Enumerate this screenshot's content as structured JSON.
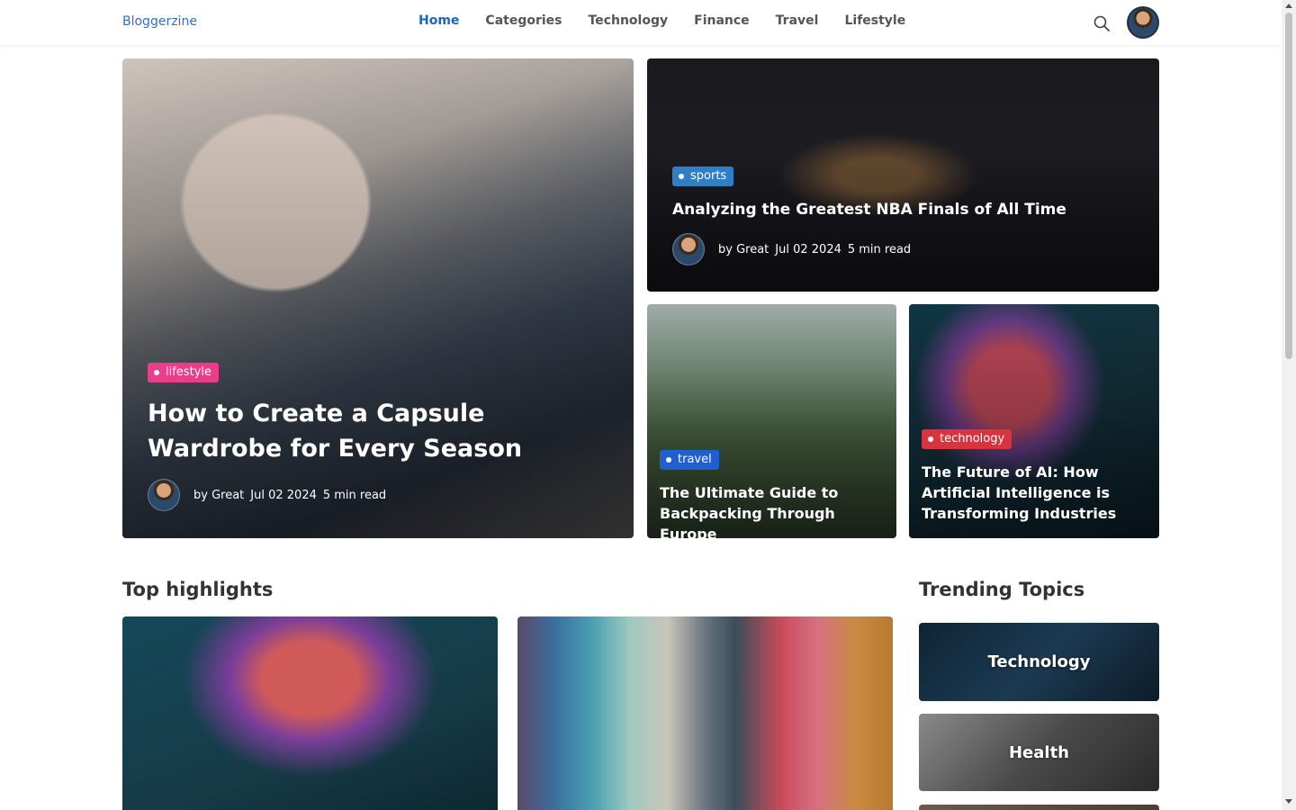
{
  "header": {
    "brand": "Bloggerzine",
    "nav": [
      "Home",
      "Categories",
      "Technology",
      "Finance",
      "Travel",
      "Lifestyle"
    ]
  },
  "featured": {
    "main": {
      "badge": "lifestyle",
      "badge_color": "#e83e8c",
      "title": "How to Create a Capsule Wardrobe for Every Season",
      "author": "by Great",
      "date": "Jul 02 2024",
      "read": "5 min read"
    },
    "sports": {
      "badge": "sports",
      "badge_color": "#2f7fc6",
      "title": "Analyzing the Greatest NBA Finals of All Time",
      "author": "by Great",
      "date": "Jul 02 2024",
      "read": "5 min read"
    },
    "travel": {
      "badge": "travel",
      "badge_color": "#1f5fd0",
      "title": "The Ultimate Guide to Backpacking Through Europe"
    },
    "technology": {
      "badge": "technology",
      "badge_color": "#d9333f",
      "title": "The Future of AI: How Artificial Intelligence is Transforming Industries"
    }
  },
  "highlights": {
    "title": "Top highlights"
  },
  "trending": {
    "title": "Trending Topics",
    "topics": [
      "Technology",
      "Health"
    ]
  }
}
